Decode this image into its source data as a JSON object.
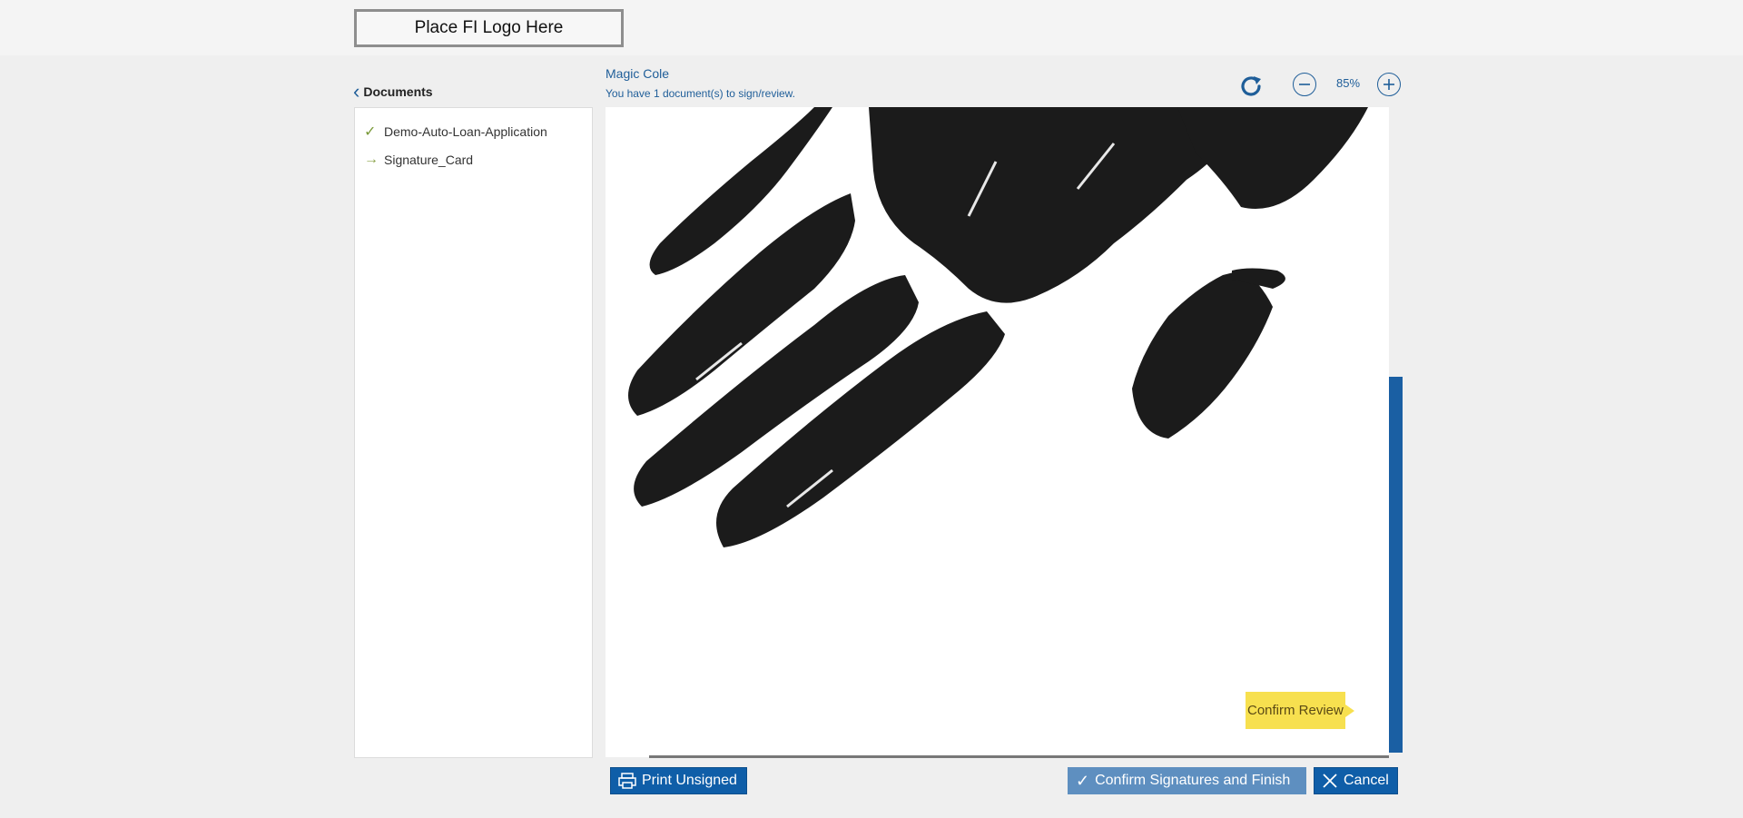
{
  "header": {
    "logo_text": "Place FI Logo Here"
  },
  "sidebar": {
    "title": "Documents",
    "items": [
      {
        "label": "Demo-Auto-Loan-Application",
        "status": "completed",
        "icon": "check-icon"
      },
      {
        "label": "Signature_Card",
        "status": "current",
        "icon": "arrow-right-icon"
      }
    ]
  },
  "viewer": {
    "signer_name": "Magic Cole",
    "message": "You have 1 document(s) to sign/review.",
    "zoom_level": "85%",
    "content": "handprint-image",
    "confirm_review_label": "Confirm Review"
  },
  "footer": {
    "print_label": "Print Unsigned",
    "finish_label": "Confirm Signatures and Finish",
    "cancel_label": "Cancel"
  },
  "colors": {
    "accent": "#0f5ea8",
    "highlight": "#f7e04f",
    "background": "#efefef"
  }
}
